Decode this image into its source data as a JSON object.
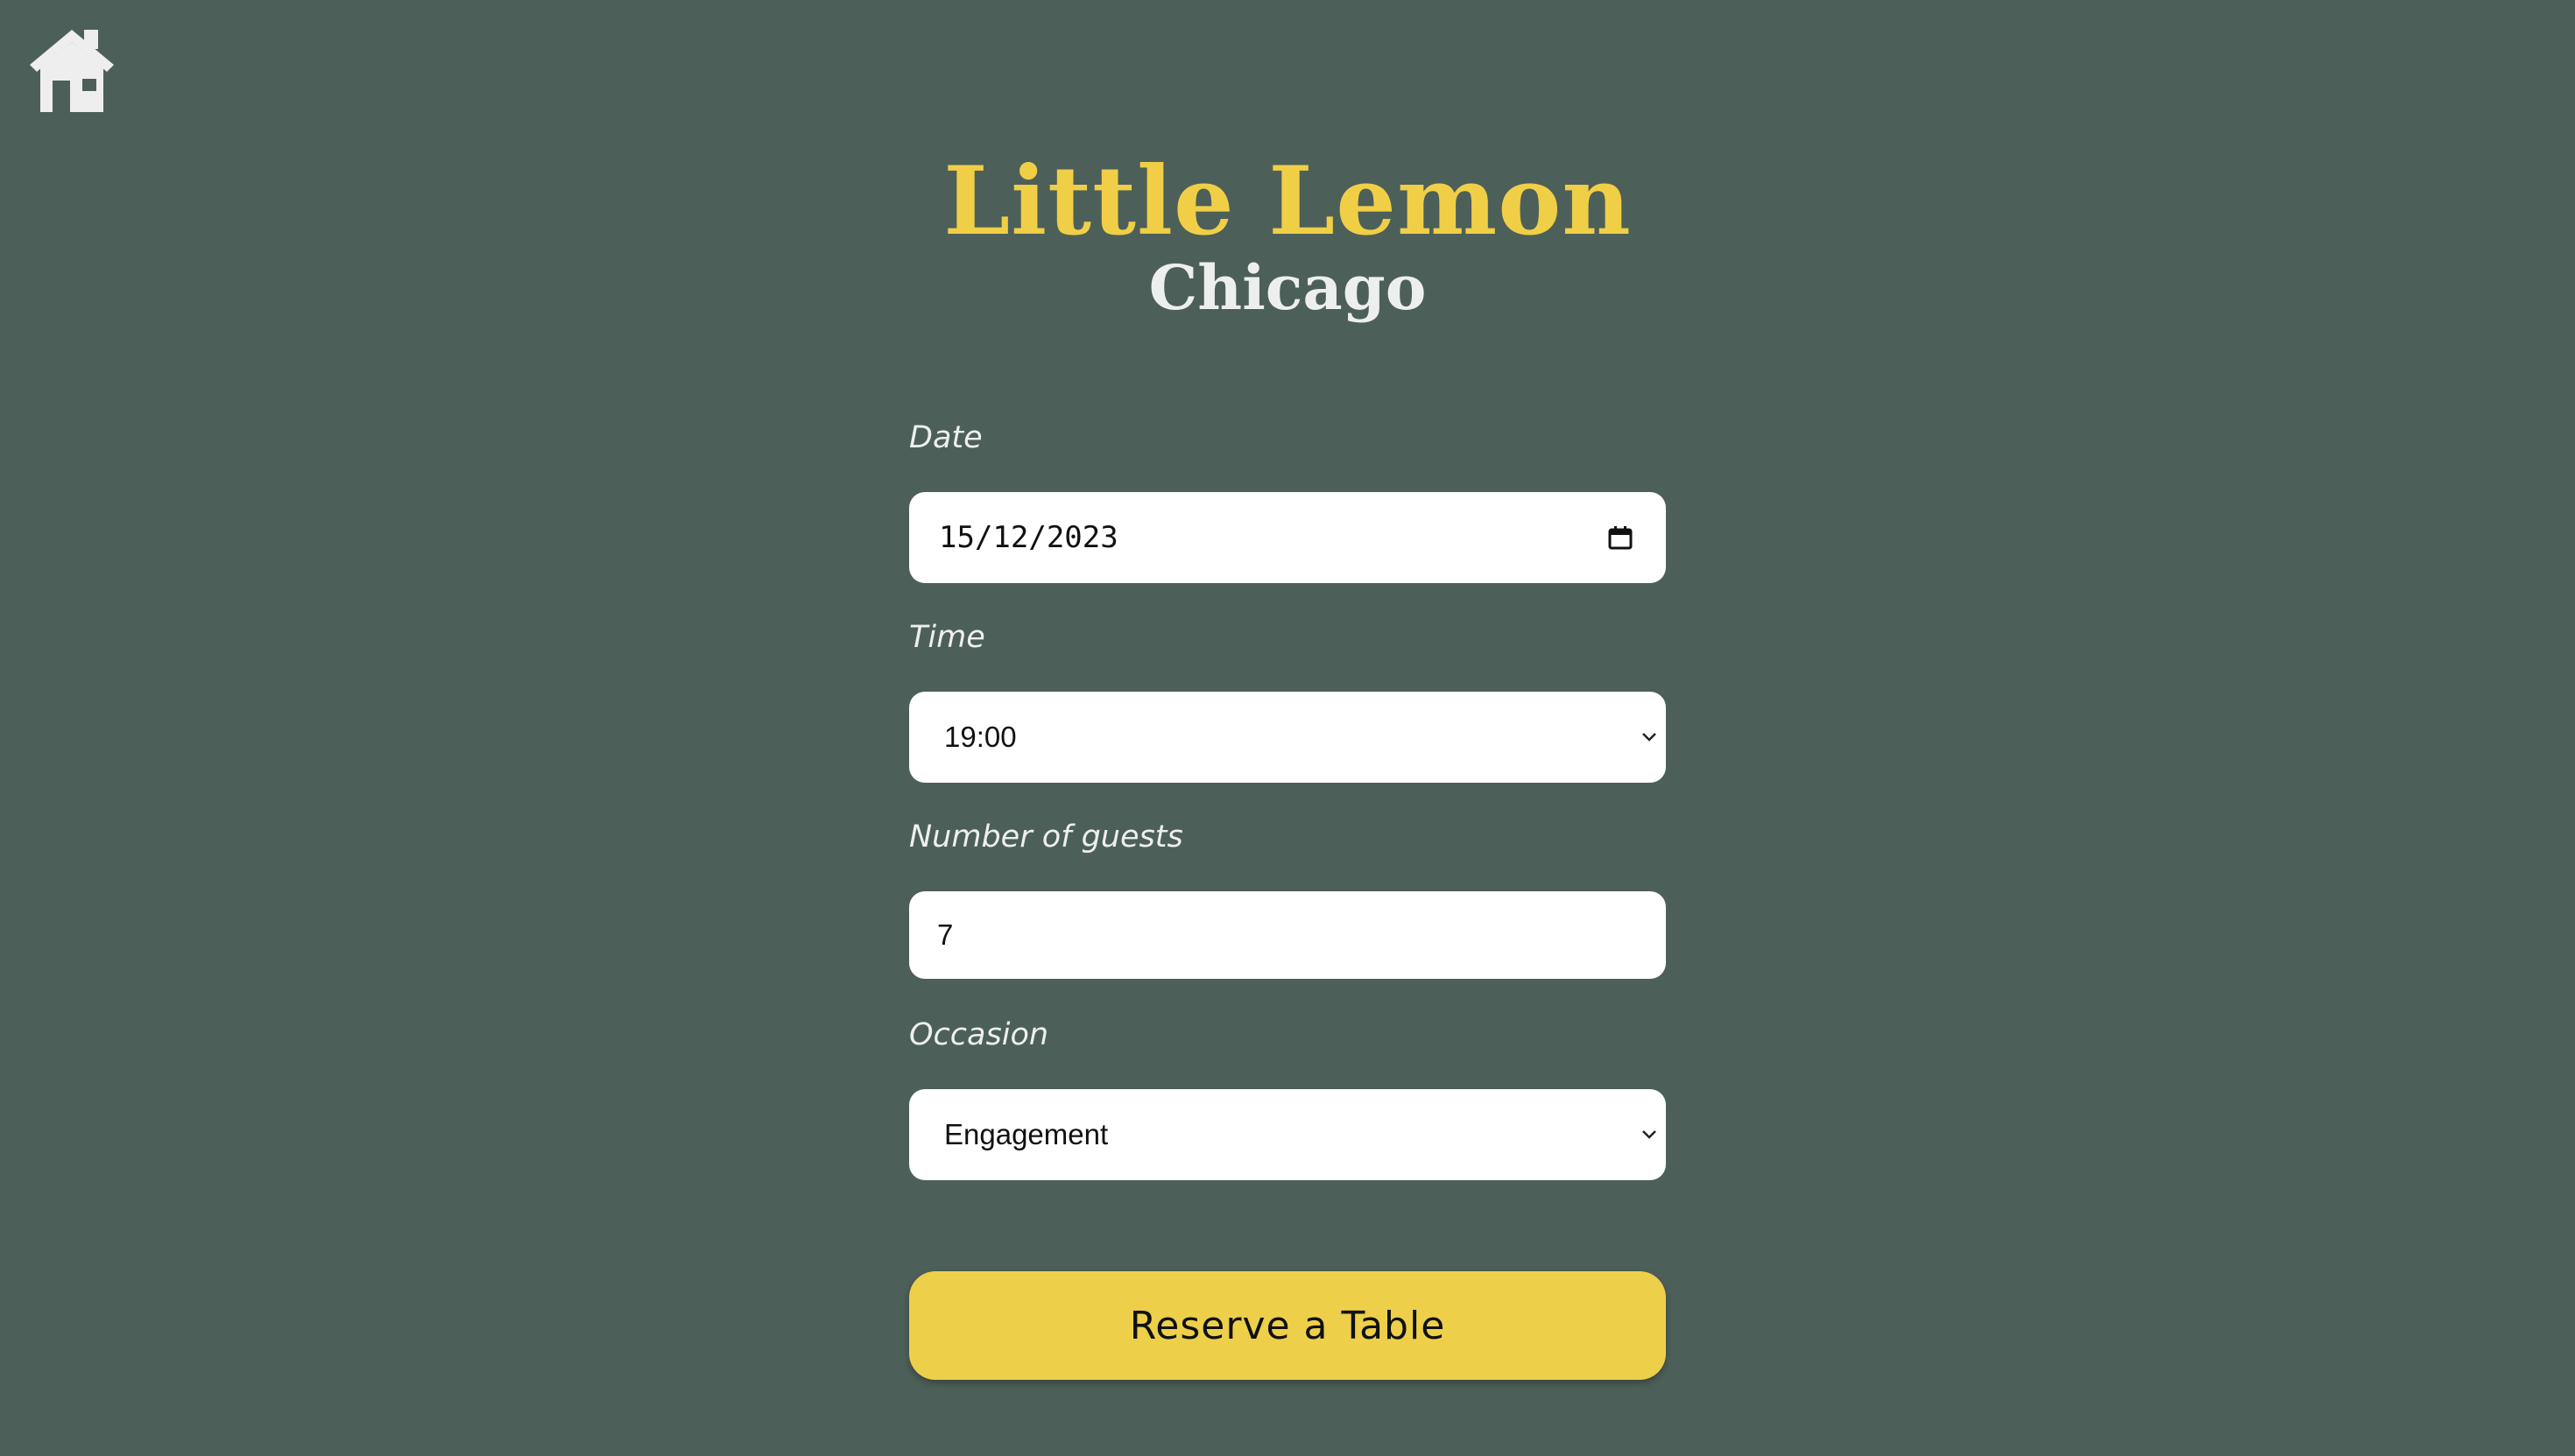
{
  "nav": {
    "home_icon": "home-icon"
  },
  "brand": {
    "title": "Little Lemon",
    "subtitle": "Chicago"
  },
  "form": {
    "date": {
      "label": "Date",
      "value": "15/12/2023",
      "icon": "calendar-icon"
    },
    "time": {
      "label": "Time",
      "value": "19:00",
      "icon": "chevron-down-icon"
    },
    "guests": {
      "label": "Number of guests",
      "value": "7"
    },
    "occasion": {
      "label": "Occasion",
      "value": "Engagement",
      "icon": "chevron-down-icon"
    },
    "submit_label": "Reserve a Table"
  },
  "colors": {
    "background": "#4d5f59",
    "brand_yellow": "#f0cf47",
    "text_light": "#edefee",
    "button_yellow": "#edcf4a",
    "field_background": "#ffffff"
  }
}
